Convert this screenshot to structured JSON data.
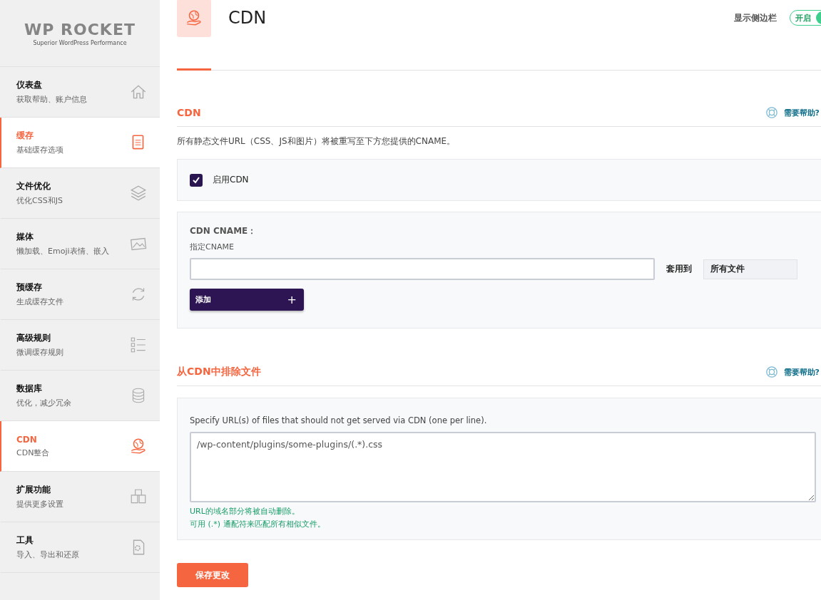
{
  "logo": {
    "name": "WP ROCKET",
    "tagline": "Superior WordPress Performance"
  },
  "sidebar": {
    "items": [
      {
        "title": "仪表盘",
        "subtitle": "获取帮助、账户信息",
        "selected": false
      },
      {
        "title": "缓存",
        "subtitle": "基础缓存选项",
        "selected": true
      },
      {
        "title": "文件优化",
        "subtitle": "优化CSS和JS",
        "selected": false
      },
      {
        "title": "媒体",
        "subtitle": "懒加载、Emoji表情、嵌入",
        "selected": false
      },
      {
        "title": "预缓存",
        "subtitle": "生成缓存文件",
        "selected": false
      },
      {
        "title": "高级规则",
        "subtitle": "微调缓存规则",
        "selected": false
      },
      {
        "title": "数据库",
        "subtitle": "优化，减少冗余",
        "selected": false
      },
      {
        "title": "CDN",
        "subtitle": "CDN整合",
        "selected": true
      },
      {
        "title": "扩展功能",
        "subtitle": "提供更多设置",
        "selected": false
      },
      {
        "title": "工具",
        "subtitle": "导入、导出和还原",
        "selected": false
      }
    ]
  },
  "header": {
    "title": "CDN",
    "sidebar_toggle": {
      "label": "显示侧边栏",
      "state_text": "开启",
      "on": true
    }
  },
  "sections": [
    {
      "title": "CDN",
      "help": "需要帮助?",
      "description": "所有静态文件URL（CSS、JS和图片）将被重写至下方您提供的CNAME。",
      "enable": {
        "label": "启用CDN",
        "checked": true
      },
      "cname": {
        "title": "CDN CNAME：",
        "label": "指定CNAME",
        "apply_label": "套用到",
        "apply_value": "所有文件",
        "add_button": "添加",
        "add_icon": "+"
      }
    },
    {
      "title": "从CDN中排除文件",
      "help": "需要帮助?",
      "exclude": {
        "description": "Specify URL(s) of files that should not get served via CDN (one per line).",
        "placeholder": "/wp-content/plugins/some-plugins/(.*).css",
        "notes": [
          "URL的域名部分将被自动删除。",
          "可用 (.*) 通配符来匹配所有相似文件。"
        ]
      }
    }
  ],
  "save_button": "保存更改"
}
